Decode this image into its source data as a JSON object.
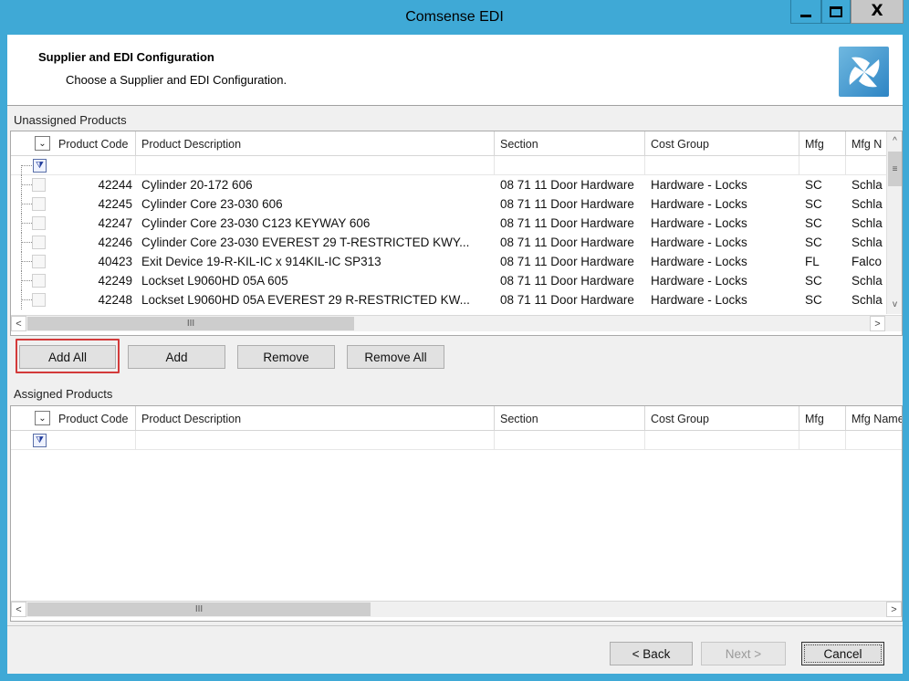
{
  "window": {
    "title": "Comsense EDI"
  },
  "header": {
    "title": "Supplier and EDI Configuration",
    "subtitle": "Choose a Supplier and EDI Configuration."
  },
  "unassigned": {
    "label": "Unassigned Products",
    "columns": [
      "Product Code",
      "Product Description",
      "Section",
      "Cost Group",
      "Mfg",
      "Mfg N"
    ],
    "rows": [
      [
        "42244",
        "Cylinder 20-172 606",
        "08 71 11 Door Hardware",
        "Hardware - Locks",
        "SC",
        "Schla"
      ],
      [
        "42245",
        "Cylinder Core 23-030 606",
        "08 71 11 Door Hardware",
        "Hardware - Locks",
        "SC",
        "Schla"
      ],
      [
        "42247",
        "Cylinder Core 23-030 C123 KEYWAY 606",
        "08 71 11 Door Hardware",
        "Hardware - Locks",
        "SC",
        "Schla"
      ],
      [
        "42246",
        "Cylinder Core 23-030 EVEREST 29 T-RESTRICTED KWY...",
        "08 71 11 Door Hardware",
        "Hardware - Locks",
        "SC",
        "Schla"
      ],
      [
        "40423",
        "Exit Device 19-R-KIL-IC x 914KIL-IC SP313",
        "08 71 11 Door Hardware",
        "Hardware - Locks",
        "FL",
        "Falco"
      ],
      [
        "42249",
        "Lockset L9060HD 05A 605",
        "08 71 11 Door Hardware",
        "Hardware - Locks",
        "SC",
        "Schla"
      ],
      [
        "42248",
        "Lockset L9060HD 05A EVEREST 29 R-RESTRICTED KW...",
        "08 71 11 Door Hardware",
        "Hardware - Locks",
        "SC",
        "Schla"
      ]
    ]
  },
  "actions": {
    "add_all": "Add All",
    "add": "Add",
    "remove": "Remove",
    "remove_all": "Remove All"
  },
  "assigned": {
    "label": "Assigned Products",
    "columns": [
      "Product Code",
      "Product Description",
      "Section",
      "Cost Group",
      "Mfg",
      "Mfg Name"
    ]
  },
  "footer": {
    "back": "< Back",
    "next": "Next >",
    "cancel": "Cancel"
  },
  "glyphs": {
    "close": "X",
    "scroll_thumb": "III",
    "scroll_left": "<",
    "scroll_right": ">",
    "scroll_up": "^",
    "scroll_down": "v",
    "grip": "≡"
  }
}
